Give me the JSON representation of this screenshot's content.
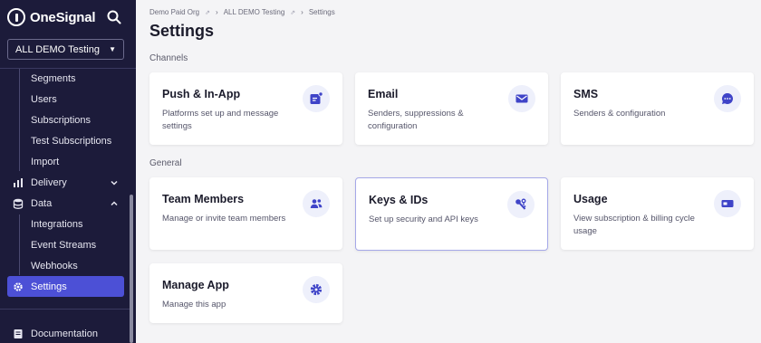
{
  "sidebar": {
    "brand": "OneSignal",
    "app_selector": "ALL DEMO Testing",
    "messages_sub": [
      "Segments",
      "Users",
      "Subscriptions",
      "Test Subscriptions",
      "Import"
    ],
    "delivery": "Delivery",
    "data": "Data",
    "data_sub": [
      "Integrations",
      "Event Streams",
      "Webhooks"
    ],
    "settings": "Settings",
    "documentation": "Documentation"
  },
  "breadcrumb": [
    "Demo Paid Org",
    "ALL DEMO Testing",
    "Settings"
  ],
  "page_title": "Settings",
  "sections": {
    "channels": "Channels",
    "general": "General"
  },
  "cards": {
    "push": {
      "title": "Push & In-App",
      "desc": "Platforms set up and message settings"
    },
    "email": {
      "title": "Email",
      "desc": "Senders, suppressions & configuration"
    },
    "sms": {
      "title": "SMS",
      "desc": "Senders & configuration"
    },
    "team": {
      "title": "Team Members",
      "desc": "Manage or invite team members"
    },
    "keys": {
      "title": "Keys & IDs",
      "desc": "Set up security and API keys"
    },
    "usage": {
      "title": "Usage",
      "desc": "View subscription & billing cycle usage"
    },
    "manage": {
      "title": "Manage App",
      "desc": "Manage this app"
    }
  },
  "colors": {
    "sidebar_bg": "#1c1b3a",
    "accent": "#4c50d6",
    "icon_fg": "#3f44c8"
  }
}
